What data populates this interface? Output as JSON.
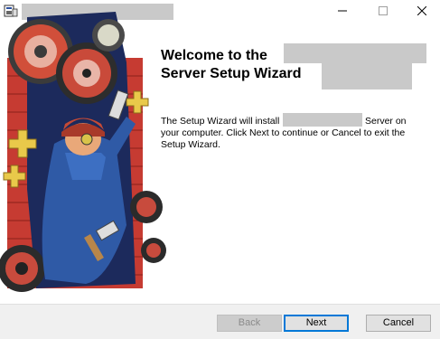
{
  "window": {
    "minimize_glyph": "—",
    "maximize_glyph": "☐",
    "close_glyph": "✕",
    "icon": "installer-icon"
  },
  "welcome": {
    "heading_line1": "Welcome to the",
    "heading_line2": "Server Setup Wizard",
    "body_line1_prefix": "The Setup Wizard will install",
    "body_line1_suffix": "Server on",
    "body_line2": "your computer. Click Next to continue or Cancel to exit the",
    "body_line3": "Setup Wizard."
  },
  "buttons": {
    "back": "Back",
    "next": "Next",
    "cancel": "Cancel",
    "back_enabled": false
  },
  "colors": {
    "accent": "#0078d7",
    "footer_bg": "#f0f0f0",
    "redaction": "#c9c9c9"
  }
}
